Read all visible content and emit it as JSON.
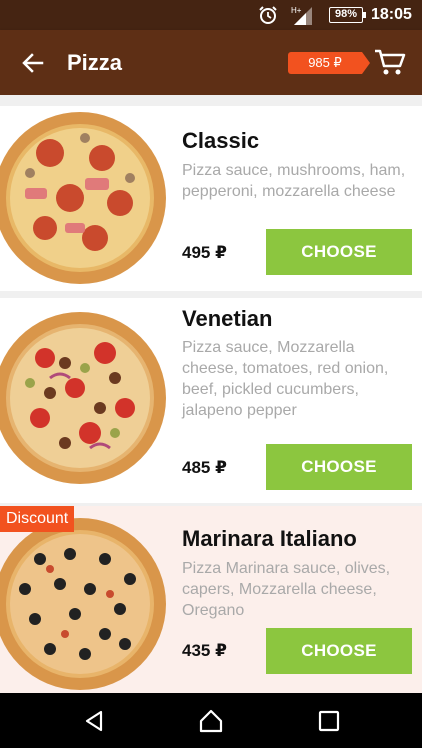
{
  "status": {
    "battery": "98%",
    "time": "18:05"
  },
  "header": {
    "title": "Pizza",
    "cart_total": "985 ₽"
  },
  "items": [
    {
      "name": "Classic",
      "description": "Pizza sauce, mushrooms, ham, pepperoni, mozzarella cheese",
      "price": "495 ₽",
      "button": "CHOOSE"
    },
    {
      "name": "Venetian",
      "description": "Pizza sauce, Mozzarella cheese, tomatoes, red onion, beef, pickled cucumbers, jalapeno pepper",
      "price": "485 ₽",
      "button": "CHOOSE"
    },
    {
      "name": "Marinara Italiano",
      "description": "Pizza Marinara sauce, olives, capers, Mozzarella cheese, Oregano",
      "price": "435 ₽",
      "button": "CHOOSE",
      "badge": "Discount"
    }
  ],
  "colors": {
    "header": "#5e2f15",
    "status_bar": "#452412",
    "accent": "#f2521f",
    "button": "#8cc63f"
  }
}
